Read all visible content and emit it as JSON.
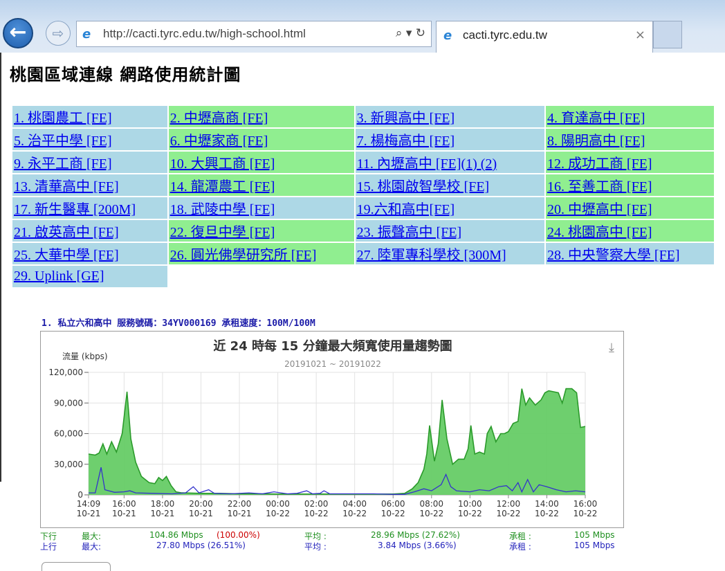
{
  "browser": {
    "back": "←",
    "forward": "⇨",
    "url": "http://cacti.tyrc.edu.tw/high-school.html",
    "url_controls": "⌕ ▾ ↻",
    "tab_title": "cacti.tyrc.edu.tw",
    "tab_close": "×"
  },
  "page": {
    "title": "桃園區域連線 網路使用統計圖",
    "schools": [
      {
        "label": "1. 桃園農工 [FE]",
        "color": "b"
      },
      {
        "label": "2. 中壢高商 [FE]",
        "color": "g"
      },
      {
        "label": "3. 新興高中 [FE]",
        "color": "b"
      },
      {
        "label": "4. 育達高中 [FE]",
        "color": "g"
      },
      {
        "label": "5. 治平中學 [FE]",
        "color": "b"
      },
      {
        "label": "6. 中壢家商 [FE]",
        "color": "g"
      },
      {
        "label": "7. 楊梅高中 [FE]",
        "color": "b"
      },
      {
        "label": "8. 陽明高中 [FE]",
        "color": "g"
      },
      {
        "label": "9. 永平工商 [FE]",
        "color": "b"
      },
      {
        "label": "10. 大興工商 [FE]",
        "color": "g"
      },
      {
        "label": "11. 內壢高中 [FE](1) (2)",
        "color": "b"
      },
      {
        "label": "12. 成功工商 [FE]",
        "color": "g"
      },
      {
        "label": "13. 清華高中 [FE]",
        "color": "b"
      },
      {
        "label": "14. 龍潭農工 [FE]",
        "color": "g"
      },
      {
        "label": "15. 桃園啟智學校 [FE]",
        "color": "b"
      },
      {
        "label": "16. 至善工商 [FE]",
        "color": "g"
      },
      {
        "label": "17. 新生醫專 [200M]",
        "color": "b"
      },
      {
        "label": "18. 武陵中學 [FE]",
        "color": "b"
      },
      {
        "label": "19.六和高中[FE]",
        "color": "b"
      },
      {
        "label": "20. 中壢高中 [FE]",
        "color": "g"
      },
      {
        "label": "21. 啟英高中 [FE]",
        "color": "b"
      },
      {
        "label": "22. 復旦中學 [FE]",
        "color": "g"
      },
      {
        "label": "23. 振聲高中 [FE]",
        "color": "b"
      },
      {
        "label": "24. 桃園高中 [FE]",
        "color": "g"
      },
      {
        "label": "25. 大華中學 [FE]",
        "color": "b"
      },
      {
        "label": "26. 圓光佛學研究所 [FE]",
        "color": "g"
      },
      {
        "label": "27. 陸軍專科學校 [300M]",
        "color": "b"
      },
      {
        "label": "28. 中央警察大學 [FE]",
        "color": "b"
      },
      {
        "label": "29. Uplink [GE]",
        "color": "b"
      }
    ],
    "graph_heading": "1. 私立六和高中 服務號碼：34YV000169 承租速度：100M/100M",
    "download_icon": "⤓"
  },
  "chart_data": {
    "type": "area",
    "title": "近 24 時每 15 分鐘最大頻寬使用量趨勢圖",
    "subtitle": "20191021 ~ 20191022",
    "ylabel": "流量 (kbps)",
    "ylim": [
      0,
      120000
    ],
    "yticks": [
      "0",
      "30,000",
      "60,000",
      "90,000",
      "120,000"
    ],
    "ytick_values": [
      0,
      30000,
      60000,
      90000,
      120000
    ],
    "xlim": [
      14.15,
      40
    ],
    "xticks": [
      {
        "t": 14.15,
        "l1": "14:09",
        "l2": "10-21"
      },
      {
        "t": 16,
        "l1": "16:00",
        "l2": "10-21"
      },
      {
        "t": 18,
        "l1": "18:00",
        "l2": "10-21"
      },
      {
        "t": 20,
        "l1": "20:00",
        "l2": "10-21"
      },
      {
        "t": 22,
        "l1": "22:00",
        "l2": "10-21"
      },
      {
        "t": 24,
        "l1": "00:00",
        "l2": "10-22"
      },
      {
        "t": 26,
        "l1": "02:00",
        "l2": "10-22"
      },
      {
        "t": 28,
        "l1": "04:00",
        "l2": "10-22"
      },
      {
        "t": 30,
        "l1": "06:00",
        "l2": "10-22"
      },
      {
        "t": 32,
        "l1": "08:00",
        "l2": "10-22"
      },
      {
        "t": 34,
        "l1": "10:00",
        "l2": "10-22"
      },
      {
        "t": 36,
        "l1": "12:00",
        "l2": "10-22"
      },
      {
        "t": 38,
        "l1": "14:00",
        "l2": "10-22"
      },
      {
        "t": 40,
        "l1": "16:00",
        "l2": "10-22"
      }
    ],
    "grid": true,
    "series": [
      {
        "name": "下行",
        "color": "#33bb33",
        "points": [
          [
            14.15,
            40000
          ],
          [
            14.5,
            39000
          ],
          [
            14.7,
            41000
          ],
          [
            14.9,
            50000
          ],
          [
            15.1,
            40000
          ],
          [
            15.35,
            52000
          ],
          [
            15.6,
            42000
          ],
          [
            15.9,
            60000
          ],
          [
            16.15,
            101000
          ],
          [
            16.35,
            55000
          ],
          [
            16.6,
            32000
          ],
          [
            16.9,
            18000
          ],
          [
            17.3,
            12000
          ],
          [
            17.6,
            11000
          ],
          [
            17.8,
            17000
          ],
          [
            18.0,
            14000
          ],
          [
            18.2,
            18000
          ],
          [
            18.45,
            9000
          ],
          [
            18.7,
            3000
          ],
          [
            19,
            2000
          ],
          [
            20,
            1500
          ],
          [
            21,
            1500
          ],
          [
            22,
            1000
          ],
          [
            23,
            1000
          ],
          [
            24,
            800
          ],
          [
            25,
            800
          ],
          [
            26,
            800
          ],
          [
            27,
            800
          ],
          [
            28,
            800
          ],
          [
            29,
            800
          ],
          [
            30,
            800
          ],
          [
            30.6,
            1500
          ],
          [
            31.0,
            6000
          ],
          [
            31.3,
            12000
          ],
          [
            31.6,
            25000
          ],
          [
            31.75,
            40000
          ],
          [
            31.9,
            68000
          ],
          [
            32.15,
            33000
          ],
          [
            32.35,
            50000
          ],
          [
            32.55,
            93000
          ],
          [
            32.8,
            55000
          ],
          [
            33.1,
            30000
          ],
          [
            33.4,
            35000
          ],
          [
            33.7,
            35000
          ],
          [
            33.9,
            45000
          ],
          [
            34.05,
            68000
          ],
          [
            34.25,
            40000
          ],
          [
            34.5,
            42000
          ],
          [
            34.75,
            40000
          ],
          [
            34.9,
            60000
          ],
          [
            35.1,
            67000
          ],
          [
            35.35,
            52000
          ],
          [
            35.6,
            60000
          ],
          [
            35.8,
            60000
          ],
          [
            36.0,
            62000
          ],
          [
            36.25,
            70000
          ],
          [
            36.5,
            72000
          ],
          [
            36.7,
            104000
          ],
          [
            36.9,
            88000
          ],
          [
            37.1,
            95000
          ],
          [
            37.4,
            88000
          ],
          [
            37.7,
            93000
          ],
          [
            37.9,
            100000
          ],
          [
            38.1,
            102000
          ],
          [
            38.35,
            101000
          ],
          [
            38.6,
            100000
          ],
          [
            38.8,
            90000
          ],
          [
            39.0,
            104000
          ],
          [
            39.3,
            104000
          ],
          [
            39.55,
            100000
          ],
          [
            39.75,
            66000
          ],
          [
            40,
            67000
          ]
        ]
      },
      {
        "name": "上行",
        "color": "#3333cc",
        "points": [
          [
            14.15,
            2000
          ],
          [
            14.5,
            2000
          ],
          [
            14.8,
            27000
          ],
          [
            15.0,
            5000
          ],
          [
            15.5,
            2500
          ],
          [
            16,
            3000
          ],
          [
            16.3,
            4000
          ],
          [
            16.6,
            2000
          ],
          [
            17.5,
            1500
          ],
          [
            18.5,
            1000
          ],
          [
            19.2,
            2000
          ],
          [
            19.6,
            8000
          ],
          [
            19.9,
            2000
          ],
          [
            20.4,
            5000
          ],
          [
            20.7,
            1500
          ],
          [
            21.5,
            1000
          ],
          [
            22.5,
            2000
          ],
          [
            23.2,
            1000
          ],
          [
            23.8,
            3000
          ],
          [
            24.5,
            1000
          ],
          [
            25,
            1500
          ],
          [
            25.5,
            4000
          ],
          [
            25.8,
            1000
          ],
          [
            26.2,
            1500
          ],
          [
            26.4,
            4000
          ],
          [
            26.7,
            1000
          ],
          [
            28,
            1000
          ],
          [
            29,
            1000
          ],
          [
            30,
            500
          ],
          [
            30.6,
            500
          ],
          [
            31.1,
            3000
          ],
          [
            31.6,
            6000
          ],
          [
            32.0,
            4000
          ],
          [
            32.5,
            10000
          ],
          [
            32.75,
            20000
          ],
          [
            33.0,
            8000
          ],
          [
            33.3,
            4000
          ],
          [
            34,
            3000
          ],
          [
            34.5,
            5000
          ],
          [
            35,
            4000
          ],
          [
            35.5,
            8000
          ],
          [
            35.9,
            9000
          ],
          [
            36.2,
            4000
          ],
          [
            36.5,
            12000
          ],
          [
            36.7,
            3000
          ],
          [
            37.0,
            15000
          ],
          [
            37.3,
            3000
          ],
          [
            37.6,
            10000
          ],
          [
            38.0,
            8000
          ],
          [
            38.5,
            5000
          ],
          [
            39.0,
            3000
          ],
          [
            39.5,
            4000
          ],
          [
            40,
            3000
          ]
        ]
      }
    ]
  },
  "stats": {
    "down": {
      "label": "下行",
      "max_label": "最大:",
      "max": "104.86 Mbps",
      "max_pct": "(100.00%)",
      "avg_label": "平均 :",
      "avg": "28.96 Mbps (27.62%)",
      "lease_label": "承租 :",
      "lease": "105 Mbps"
    },
    "up": {
      "label": "上行",
      "max_label": "最大:",
      "max": "27.80 Mbps (26.51%)",
      "max_pct": "",
      "avg_label": "平均 :",
      "avg": "3.84 Mbps (3.66%)",
      "lease_label": "承租 :",
      "lease": "105 Mbps"
    }
  },
  "colors": {
    "down": "#2a9a2a",
    "down_fill": "#66cc66",
    "up": "#3333cc",
    "max_pct": "#cc0000"
  }
}
